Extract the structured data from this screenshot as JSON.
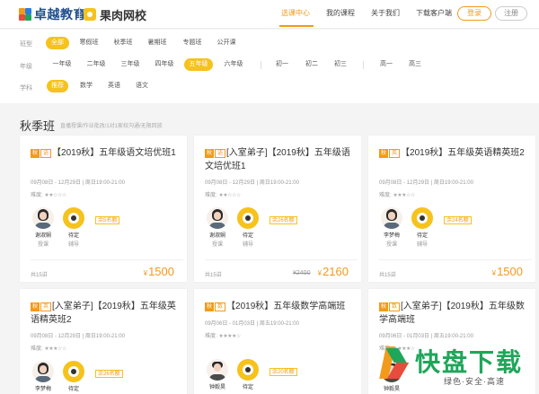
{
  "header": {
    "logo_primary": "卓越教育",
    "logo_secondary": "果肉网校",
    "nav": [
      "选课中心",
      "我的课程",
      "关于我们",
      "下载客户端"
    ],
    "active_nav": "选课中心",
    "login_label": "登录",
    "register_label": "注册"
  },
  "filters": {
    "type_label": "班型",
    "types": [
      "全部",
      "寒假班",
      "秋季班",
      "暑期班",
      "专题班",
      "公开课"
    ],
    "type_active": "全部",
    "grade_label": "年级",
    "grades_primary": [
      "一年级",
      "二年级",
      "三年级",
      "四年级",
      "五年级",
      "六年级"
    ],
    "grades_middle": [
      "初一",
      "初二",
      "初三"
    ],
    "grades_high": [
      "高一",
      "高三"
    ],
    "grade_active": "五年级",
    "subject_label": "学科",
    "subjects": [
      "推荐",
      "数学",
      "英语",
      "语文"
    ],
    "subject_active": "推荐"
  },
  "section": {
    "title": "秋季班",
    "subtitle": "直播授课/作业批改/1对1家校沟通/无限回放"
  },
  "course_labels": {
    "difficulty": "难度:",
    "role_teacher": "授课",
    "role_tutor": "辅导",
    "tutor_name": "待定",
    "currency": "¥"
  },
  "courses": [
    {
      "tags": [
        "秋",
        "语"
      ],
      "title": "【2019秋】五年级语文培优班1",
      "date": "09月08日 - 12月29日 | 周日19:00-21:00",
      "stars": "★★☆☆☆",
      "teacher": "谢淑娴",
      "seats": "余5名额",
      "lessons": "共15讲",
      "price": "1500",
      "orig_price": ""
    },
    {
      "tags": [
        "秋",
        "语"
      ],
      "title": "[入室弟子]【2019秋】五年级语文培优班1",
      "date": "09月08日 - 12月29日 | 周日19:00-21:00",
      "stars": "★★☆☆☆",
      "teacher": "谢淑娴",
      "seats": "余26名额",
      "lessons": "共15讲",
      "price": "2160",
      "orig_price": "¥2400"
    },
    {
      "tags": [
        "秋",
        "英"
      ],
      "title": "【2019秋】五年级英语精英班2",
      "date": "09月08日 - 12月29日 | 周日19:00-21:00",
      "stars": "★★★☆☆",
      "teacher": "李梦梅",
      "seats": "余24名额",
      "lessons": "共15讲",
      "price": "1500",
      "orig_price": ""
    },
    {
      "tags": [
        "秋",
        "英"
      ],
      "title": "[入室弟子]【2019秋】五年级英语精英班2",
      "date": "09月08日 - 12月29日 | 周日19:00-21:00",
      "stars": "★★★☆☆",
      "teacher": "李梦梅",
      "seats": "余26名额",
      "lessons": "",
      "price": "",
      "orig_price": ""
    },
    {
      "tags": [
        "秋",
        "数"
      ],
      "title": "【2019秋】五年级数学高端班",
      "date": "09月06日 - 01月03日 | 周五19:00-21:00",
      "stars": "★★★★☆",
      "teacher": "钟毅昊",
      "seats": "余20名额",
      "lessons": "",
      "price": "",
      "orig_price": ""
    },
    {
      "tags": [
        "秋",
        "数"
      ],
      "title": "[入室弟子]【2019秋】五年级数学高端班",
      "date": "09月06日 - 01月03日 | 周五19:00-21:00",
      "stars": "★★★★☆",
      "teacher": "钟毅昊",
      "seats": "",
      "lessons": "",
      "price": "",
      "orig_price": ""
    }
  ],
  "watermark": {
    "big": "快盘下载",
    "small": "绿色·安全·高速"
  },
  "colors": {
    "accent": "#f29a1b",
    "chip_active": "#f6c21c",
    "watermark_green": "#1fa65a"
  }
}
